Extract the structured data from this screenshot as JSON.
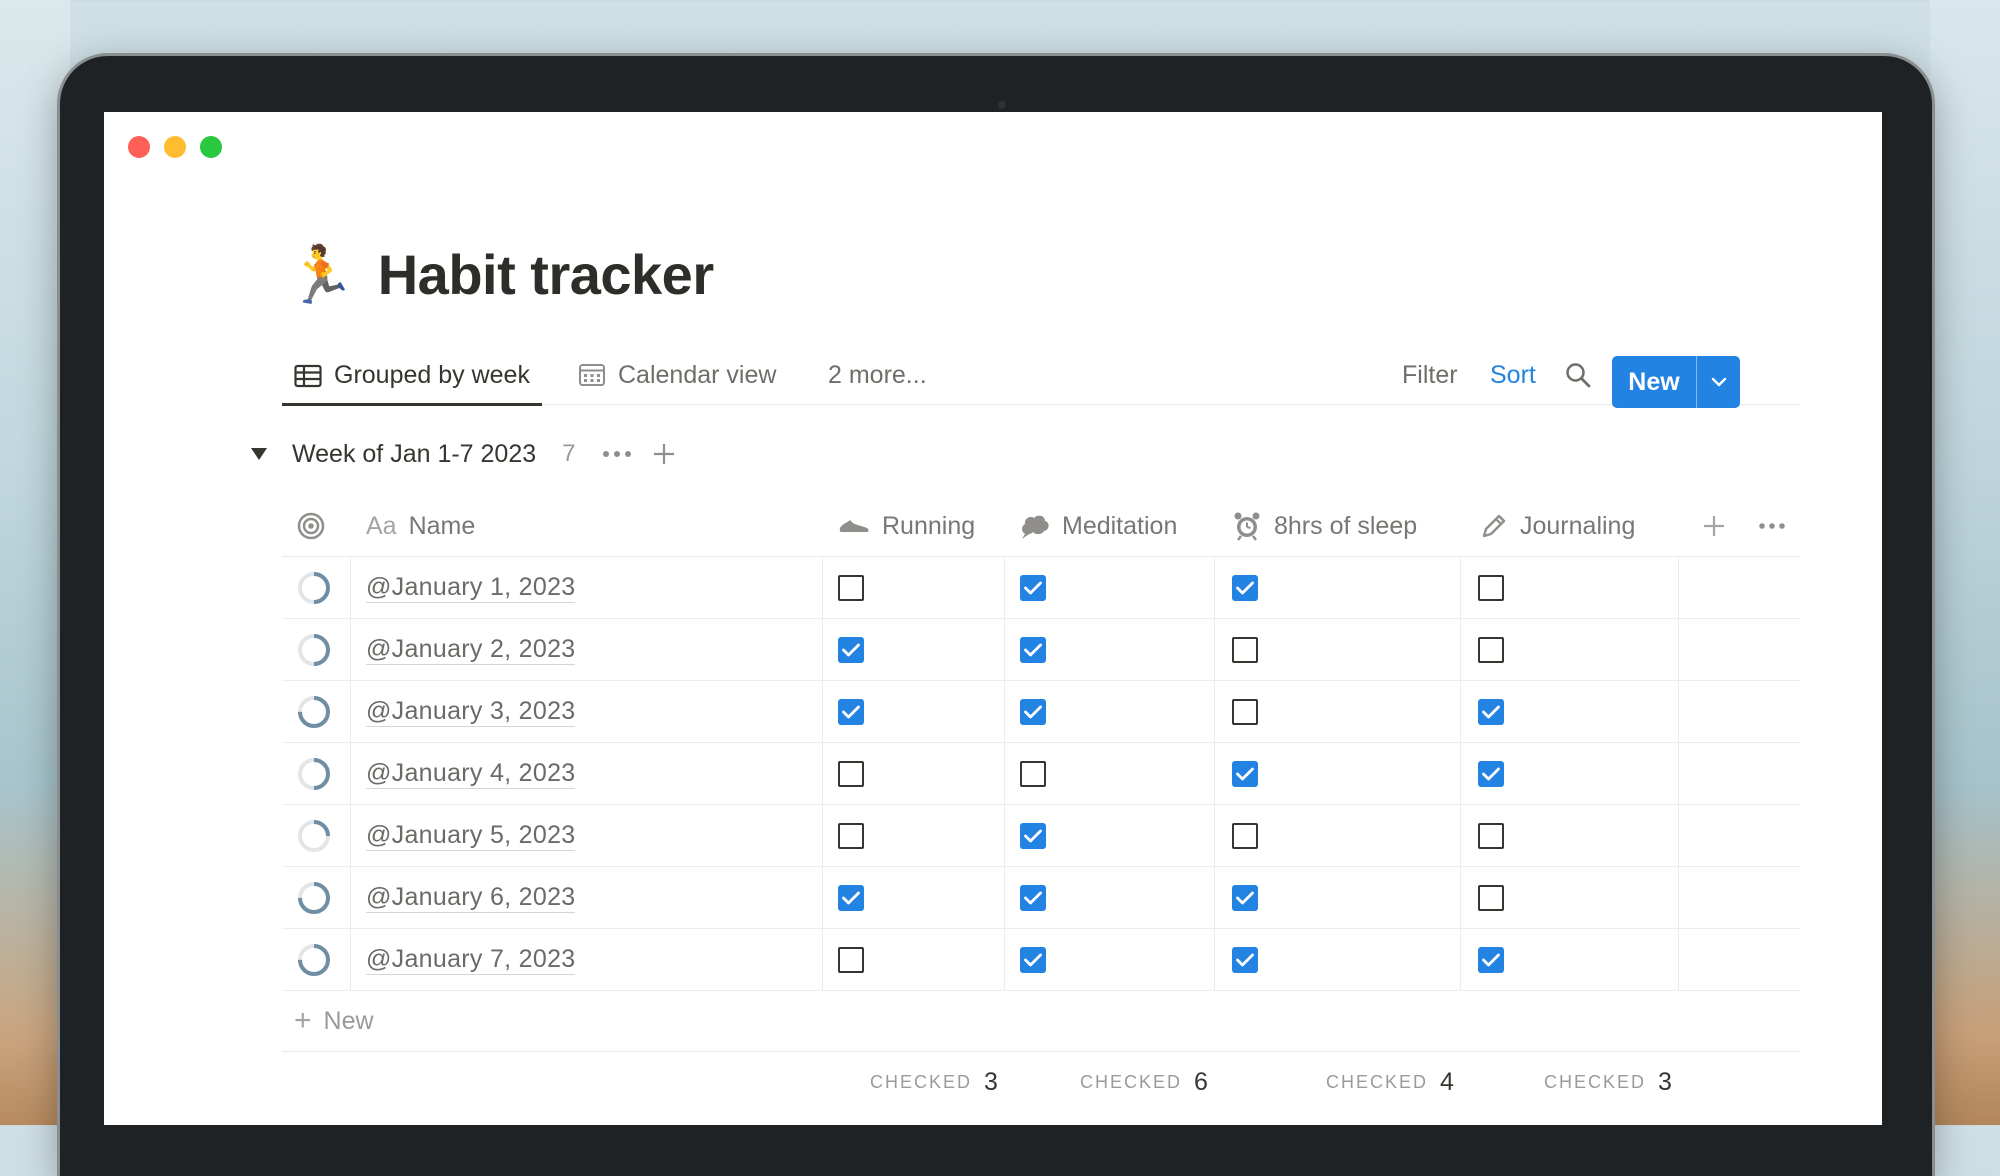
{
  "page": {
    "emoji": "🏃",
    "title": "Habit tracker"
  },
  "tabs": [
    {
      "label": "Grouped by week",
      "icon": "table-icon",
      "active": true
    },
    {
      "label": "Calendar view",
      "icon": "calendar-icon",
      "active": false
    },
    {
      "label": "2 more...",
      "icon": "",
      "active": false
    }
  ],
  "toolbar": {
    "filter_label": "Filter",
    "sort_label": "Sort",
    "new_label": "New",
    "accent_color": "#2383e2"
  },
  "group": {
    "name": "Week of Jan 1-7 2023",
    "count": "7"
  },
  "columns": [
    {
      "key": "name",
      "label": "Name",
      "icon": "Aa"
    },
    {
      "key": "running",
      "label": "Running",
      "icon": "shoe-icon"
    },
    {
      "key": "meditation",
      "label": "Meditation",
      "icon": "thought-bubble-icon"
    },
    {
      "key": "sleep",
      "label": "8hrs of sleep",
      "icon": "alarm-clock-icon"
    },
    {
      "key": "journaling",
      "label": "Journaling",
      "icon": "pencil-icon"
    }
  ],
  "rows": [
    {
      "date": "@January 1, 2023",
      "progress": 0.5,
      "running": false,
      "meditation": true,
      "sleep": true,
      "journaling": false
    },
    {
      "date": "@January 2, 2023",
      "progress": 0.5,
      "running": true,
      "meditation": true,
      "sleep": false,
      "journaling": false
    },
    {
      "date": "@January 3, 2023",
      "progress": 0.75,
      "running": true,
      "meditation": true,
      "sleep": false,
      "journaling": true
    },
    {
      "date": "@January 4, 2023",
      "progress": 0.5,
      "running": false,
      "meditation": false,
      "sleep": true,
      "journaling": true
    },
    {
      "date": "@January 5, 2023",
      "progress": 0.25,
      "running": false,
      "meditation": true,
      "sleep": false,
      "journaling": false
    },
    {
      "date": "@January 6, 2023",
      "progress": 0.75,
      "running": true,
      "meditation": true,
      "sleep": true,
      "journaling": false
    },
    {
      "date": "@January 7, 2023",
      "progress": 0.75,
      "running": false,
      "meditation": true,
      "sleep": true,
      "journaling": true
    }
  ],
  "new_row_label": "New",
  "summary": [
    {
      "label": "CHECKED",
      "value": "3"
    },
    {
      "label": "CHECKED",
      "value": "6"
    },
    {
      "label": "CHECKED",
      "value": "4"
    },
    {
      "label": "CHECKED",
      "value": "3"
    }
  ]
}
